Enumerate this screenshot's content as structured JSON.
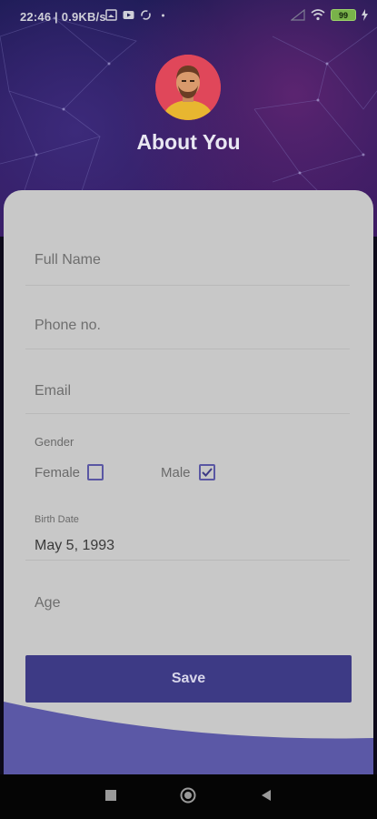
{
  "status_bar": {
    "time": "22:46 | 0.9KB/s",
    "battery": "99",
    "icons": [
      "image-icon",
      "youtube-icon",
      "sync-icon",
      "dot-icon",
      "signal-icon",
      "wifi-icon",
      "battery-icon",
      "charging-icon"
    ]
  },
  "header": {
    "title": "About You"
  },
  "form": {
    "full_name_placeholder": "Full Name",
    "phone_placeholder": "Phone no.",
    "email_placeholder": "Email",
    "gender_label": "Gender",
    "gender_options": [
      {
        "label": "Female",
        "checked": false
      },
      {
        "label": "Male",
        "checked": true
      }
    ],
    "birth_date_label": "Birth Date",
    "birth_date_value": "May 5, 1993",
    "age_placeholder": "Age",
    "save_label": "Save"
  },
  "colors": {
    "accent": "#3d3a85",
    "card": "#c8c8c8",
    "wave": "#5b58a6"
  },
  "nav_bar": {
    "icons": [
      "square-icon",
      "home-circle-icon",
      "back-triangle-icon"
    ]
  }
}
